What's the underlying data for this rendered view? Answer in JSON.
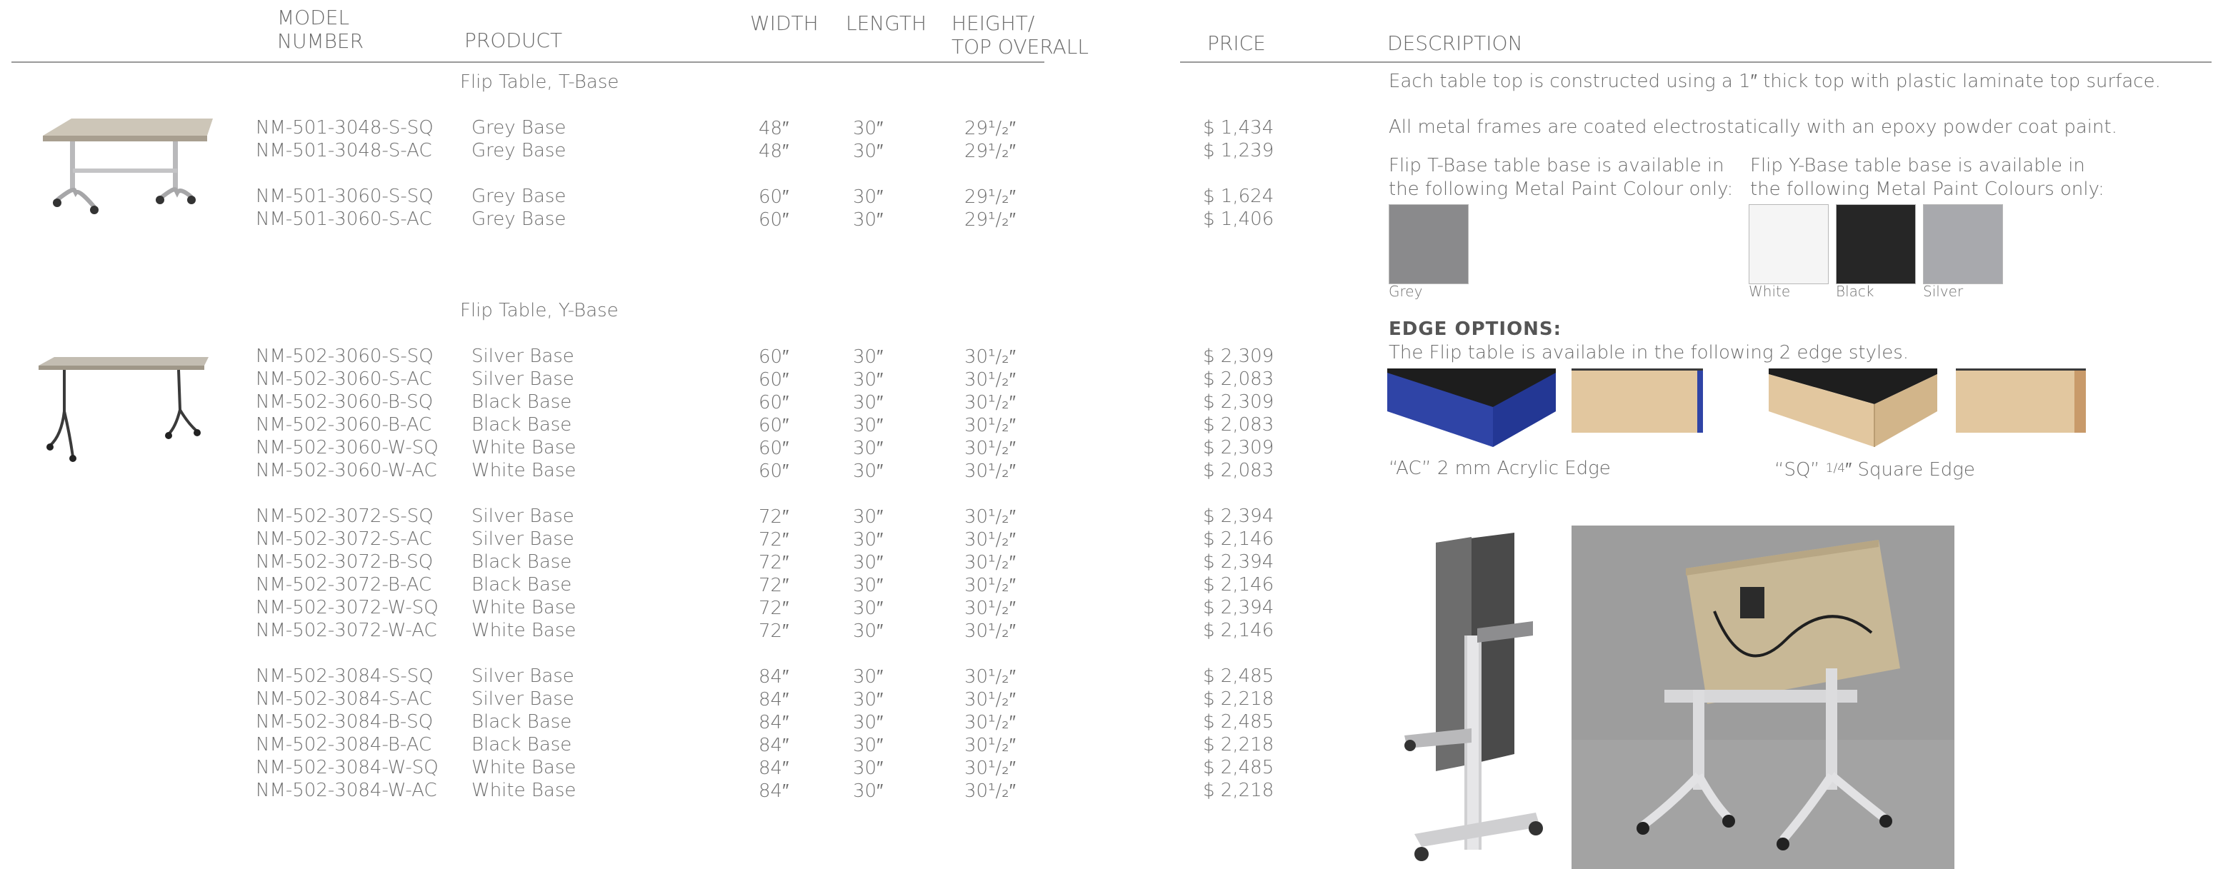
{
  "headers": {
    "model_line1": "MODEL",
    "model_line2": "NUMBER",
    "product": "PRODUCT",
    "width": "WIDTH",
    "length": "LENGTH",
    "height_line1": "HEIGHT/",
    "height_line2": "TOP OVERALL",
    "price": "PRICE",
    "description": "DESCRIPTION"
  },
  "section_t": {
    "title": "Flip Table, T-Base",
    "rows": [
      {
        "model": "NM-501-3048-S-SQ",
        "product": "Grey Base",
        "width": "48″",
        "length": "30″",
        "height": "29¹/₂″",
        "price": "$ 1,434"
      },
      {
        "model": "NM-501-3048-S-AC",
        "product": "Grey Base",
        "width": "48″",
        "length": "30″",
        "height": "29¹/₂″",
        "price": "$ 1,239"
      },
      {
        "model": "NM-501-3060-S-SQ",
        "product": "Grey Base",
        "width": "60″",
        "length": "30″",
        "height": "29¹/₂″",
        "price": "$ 1,624"
      },
      {
        "model": "NM-501-3060-S-AC",
        "product": "Grey Base",
        "width": "60″",
        "length": "30″",
        "height": "29¹/₂″",
        "price": "$ 1,406"
      }
    ]
  },
  "section_y": {
    "title": "Flip Table, Y-Base",
    "rows": [
      {
        "model": "NM-502-3060-S-SQ",
        "product": "Silver Base",
        "width": "60″",
        "length": "30″",
        "height": "30¹/₂″",
        "price": "$ 2,309"
      },
      {
        "model": "NM-502-3060-S-AC",
        "product": "Silver Base",
        "width": "60″",
        "length": "30″",
        "height": "30¹/₂″",
        "price": "$ 2,083"
      },
      {
        "model": "NM-502-3060-B-SQ",
        "product": "Black Base",
        "width": "60″",
        "length": "30″",
        "height": "30¹/₂″",
        "price": "$ 2,309"
      },
      {
        "model": "NM-502-3060-B-AC",
        "product": "Black Base",
        "width": "60″",
        "length": "30″",
        "height": "30¹/₂″",
        "price": "$ 2,083"
      },
      {
        "model": "NM-502-3060-W-SQ",
        "product": "White Base",
        "width": "60″",
        "length": "30″",
        "height": "30¹/₂″",
        "price": "$ 2,309"
      },
      {
        "model": "NM-502-3060-W-AC",
        "product": "White Base",
        "width": "60″",
        "length": "30″",
        "height": "30¹/₂″",
        "price": "$ 2,083"
      },
      {
        "model": "NM-502-3072-S-SQ",
        "product": "Silver Base",
        "width": "72″",
        "length": "30″",
        "height": "30¹/₂″",
        "price": "$ 2,394"
      },
      {
        "model": "NM-502-3072-S-AC",
        "product": "Silver Base",
        "width": "72″",
        "length": "30″",
        "height": "30¹/₂″",
        "price": "$ 2,146"
      },
      {
        "model": "NM-502-3072-B-SQ",
        "product": "Black Base",
        "width": "72″",
        "length": "30″",
        "height": "30¹/₂″",
        "price": "$ 2,394"
      },
      {
        "model": "NM-502-3072-B-AC",
        "product": "Black Base",
        "width": "72″",
        "length": "30″",
        "height": "30¹/₂″",
        "price": "$ 2,146"
      },
      {
        "model": "NM-502-3072-W-SQ",
        "product": "White Base",
        "width": "72″",
        "length": "30″",
        "height": "30¹/₂″",
        "price": "$ 2,394"
      },
      {
        "model": "NM-502-3072-W-AC",
        "product": "White Base",
        "width": "72″",
        "length": "30″",
        "height": "30¹/₂″",
        "price": "$ 2,146"
      },
      {
        "model": "NM-502-3084-S-SQ",
        "product": "Silver Base",
        "width": "84″",
        "length": "30″",
        "height": "30¹/₂″",
        "price": "$ 2,485"
      },
      {
        "model": "NM-502-3084-S-AC",
        "product": "Silver Base",
        "width": "84″",
        "length": "30″",
        "height": "30¹/₂″",
        "price": "$ 2,218"
      },
      {
        "model": "NM-502-3084-B-SQ",
        "product": "Black Base",
        "width": "84″",
        "length": "30″",
        "height": "30¹/₂″",
        "price": "$ 2,485"
      },
      {
        "model": "NM-502-3084-B-AC",
        "product": "Black Base",
        "width": "84″",
        "length": "30″",
        "height": "30¹/₂″",
        "price": "$ 2,218"
      },
      {
        "model": "NM-502-3084-W-SQ",
        "product": "White Base",
        "width": "84″",
        "length": "30″",
        "height": "30¹/₂″",
        "price": "$ 2,485"
      },
      {
        "model": "NM-502-3084-W-AC",
        "product": "White Base",
        "width": "84″",
        "length": "30″",
        "height": "30¹/₂″",
        "price": "$ 2,218"
      }
    ]
  },
  "description": {
    "line1": "Each table top is constructed using a 1″ thick top with plastic laminate top surface.",
    "line2": "All metal frames are coated electrostatically with an epoxy powder coat paint.",
    "t_base_l1": "Flip T-Base table base is available in",
    "t_base_l2": "the following Metal Paint Colour only:",
    "y_base_l1": "Flip Y-Base table base is available in",
    "y_base_l2": "the following Metal Paint Colours only:",
    "swatch_grey": "Grey",
    "swatch_white": "White",
    "swatch_black": "Black",
    "swatch_silver": "Silver",
    "edge_title": "EDGE OPTIONS:",
    "edge_subtitle": "The Flip table is available in the following 2 edge styles.",
    "edge_ac": "“AC” 2 mm Acrylic Edge",
    "edge_sq_prefix": "“SQ” ",
    "edge_sq_frac": "1/4",
    "edge_sq_suffix": "″ Square Edge"
  },
  "colors": {
    "grey": "#8a8a8c",
    "white": "#f5f5f5",
    "black": "#262626",
    "silver": "#a8a9ad",
    "acrylic_blue": "#2f44a6",
    "wood": "#e2c79f"
  }
}
